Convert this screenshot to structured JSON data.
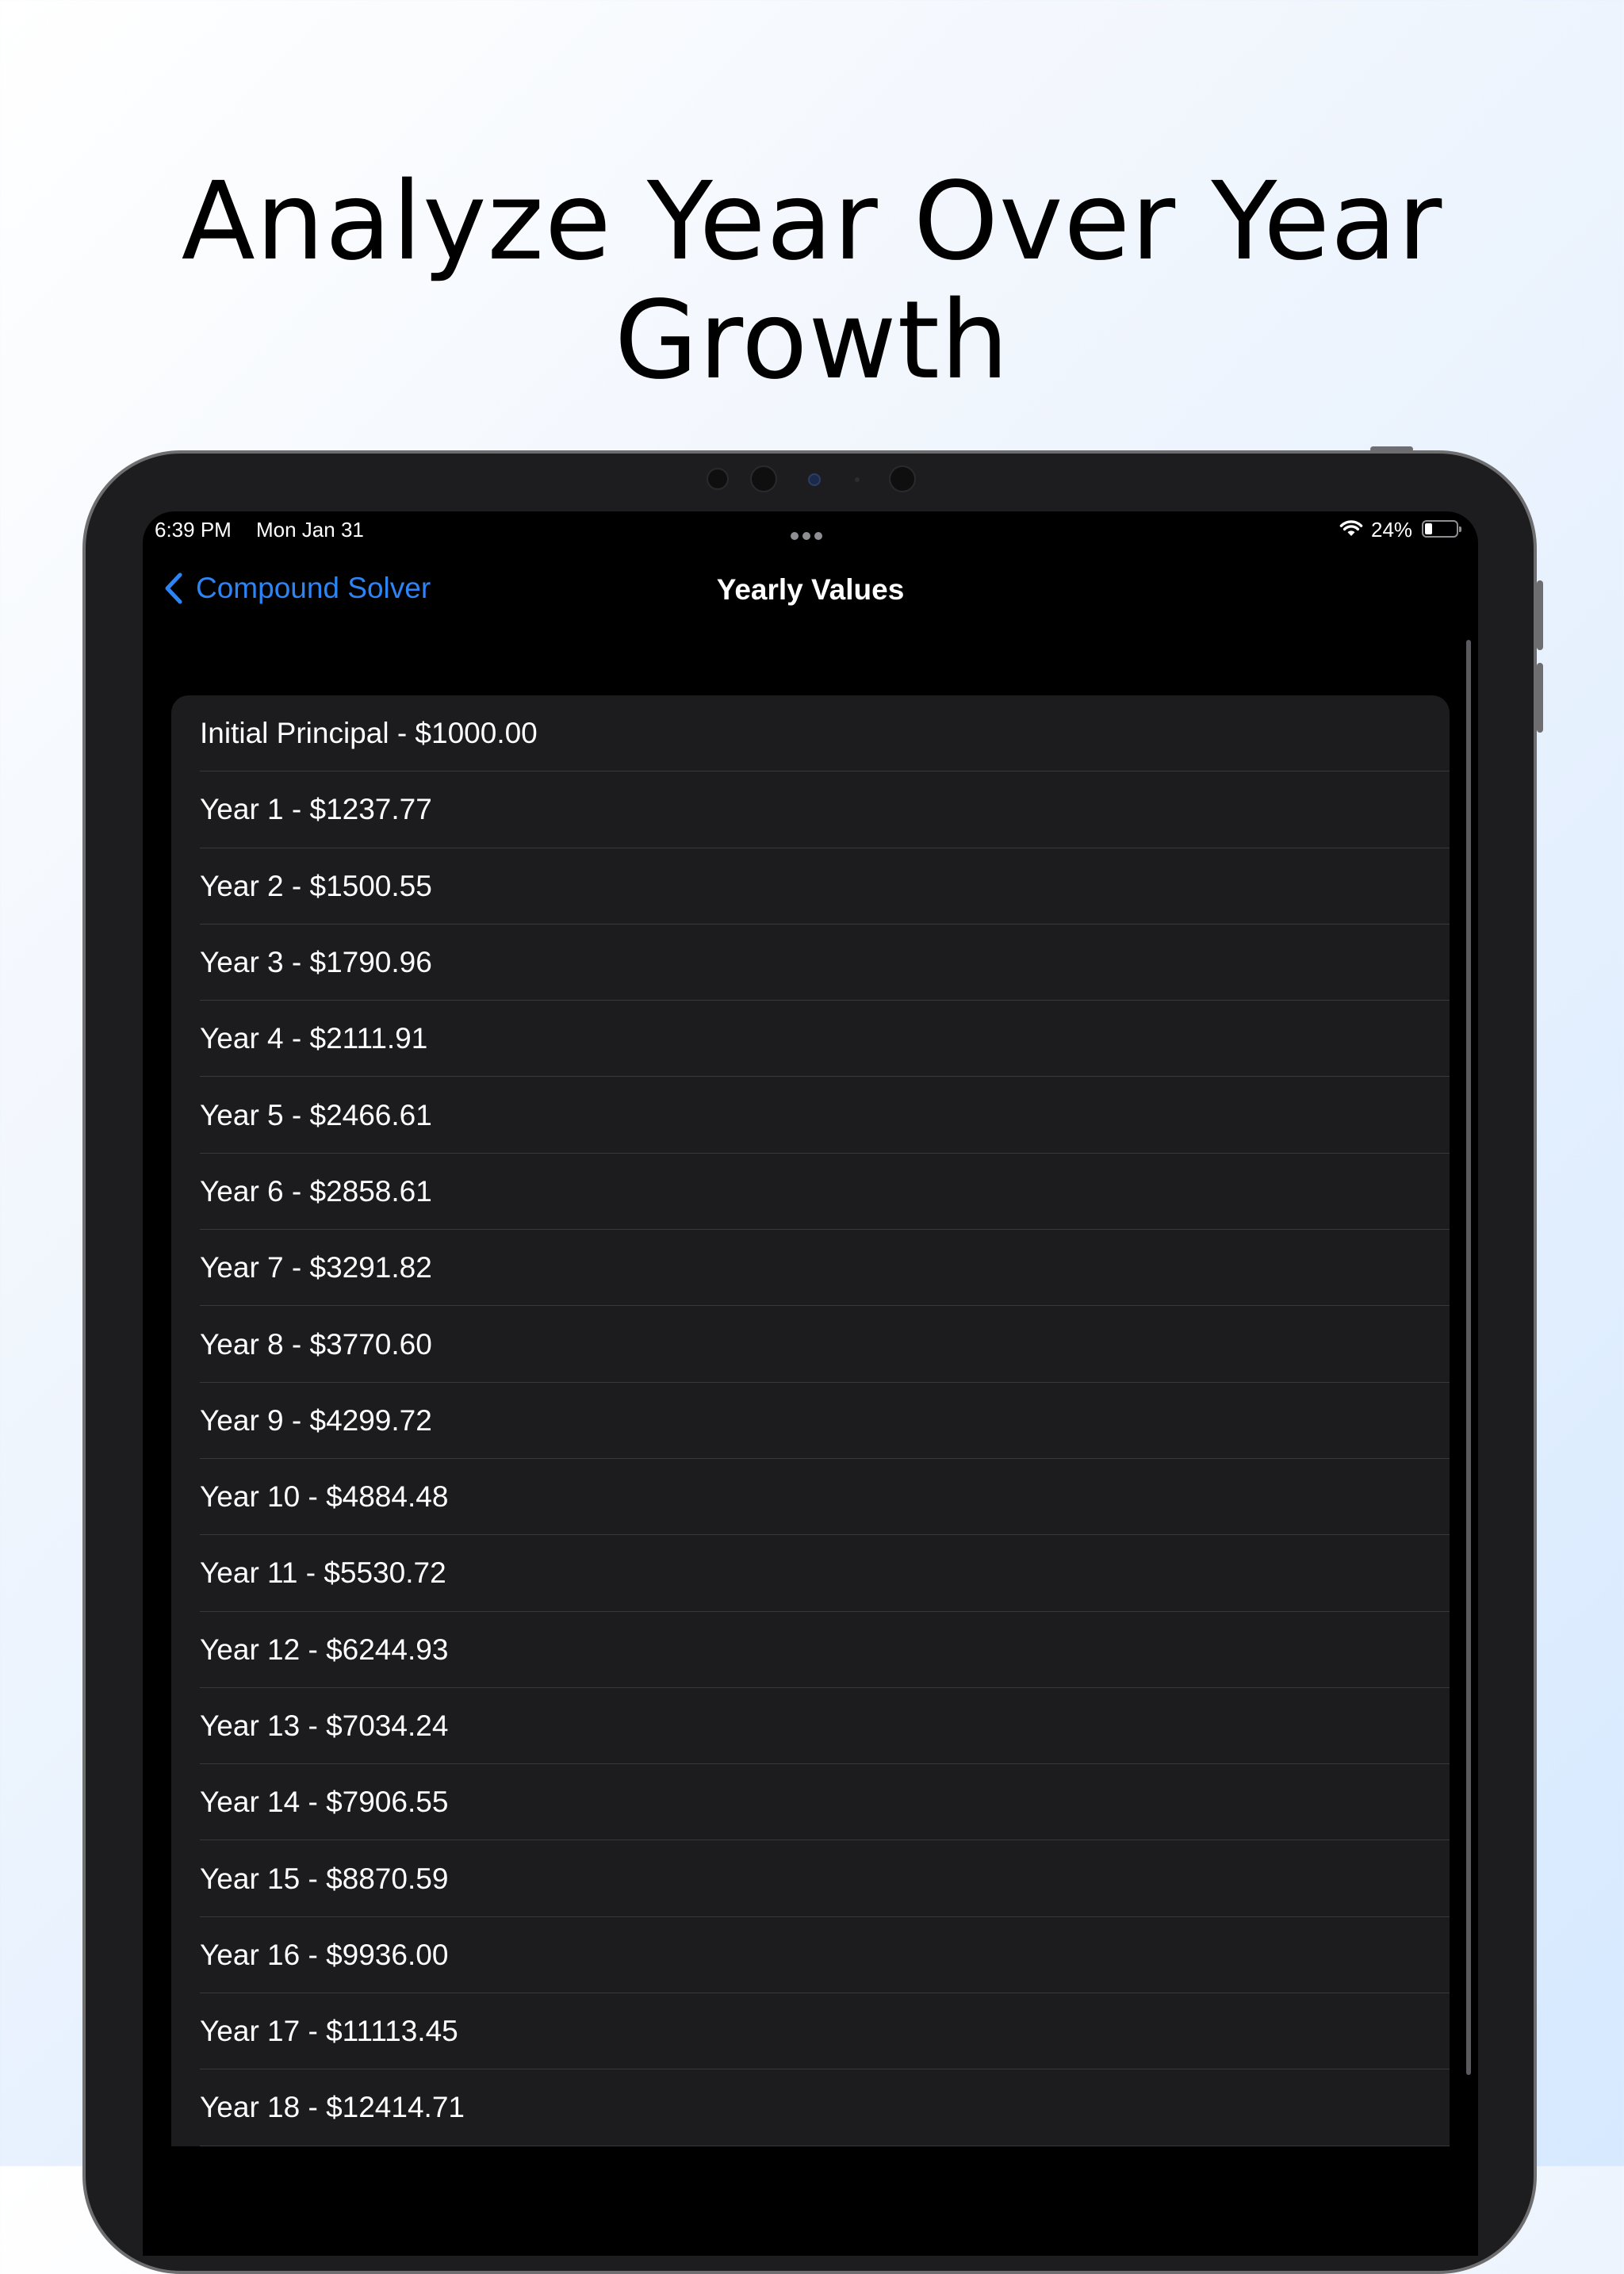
{
  "headline": {
    "line1": "Analyze Year Over Year",
    "line2": "Growth"
  },
  "status_bar": {
    "time": "6:39 PM",
    "date": "Mon Jan 31",
    "battery_percent": "24%",
    "battery_level": 0.24
  },
  "nav": {
    "back_label": "Compound Solver",
    "title": "Yearly Values",
    "accent_color": "#2c84f5"
  },
  "values": [
    "Initial Principal - $1000.00",
    "Year 1 - $1237.77",
    "Year 2 - $1500.55",
    "Year 3 - $1790.96",
    "Year 4 - $2111.91",
    "Year 5 - $2466.61",
    "Year 6 - $2858.61",
    "Year 7 - $3291.82",
    "Year 8 - $3770.60",
    "Year 9 - $4299.72",
    "Year 10 - $4884.48",
    "Year 11 - $5530.72",
    "Year 12 - $6244.93",
    "Year 13 - $7034.24",
    "Year 14 - $7906.55",
    "Year 15 - $8870.59",
    "Year 16 - $9936.00",
    "Year 17 - $11113.45",
    "Year 18 - $12414.71"
  ]
}
